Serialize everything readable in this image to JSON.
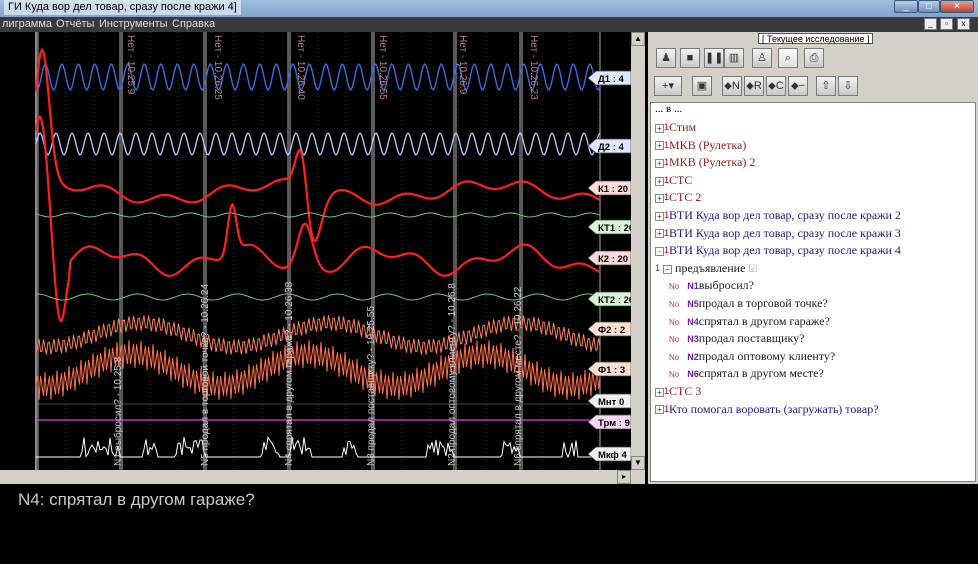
{
  "window": {
    "title": "ГИ Куда вор дел товар, сразу после кражи  4]",
    "controls": [
      "_",
      "□",
      "✕"
    ]
  },
  "menu": [
    "лиграмма",
    "Отчёты",
    "Инструменты",
    "Справка"
  ],
  "mdi_controls": [
    "_",
    "▫",
    "x"
  ],
  "channels": [
    {
      "label": "Д1 : 4",
      "color": "#4a78e0"
    },
    {
      "label": "Д2 : 4",
      "color": "#9ec8ff"
    },
    {
      "label": "К1 : 20",
      "color": "#ff2a2a"
    },
    {
      "label": "КТ1 : 20",
      "color": "#7fd17f"
    },
    {
      "label": "К2 : 20",
      "color": "#ff2a2a"
    },
    {
      "label": "КТ2 : 20",
      "color": "#7fd17f"
    },
    {
      "label": "Ф2 : 2",
      "color": "#ff8a66"
    },
    {
      "label": "Ф1 : 3",
      "color": "#ff8a66"
    },
    {
      "label": "Мнт 0",
      "color": "#ffffff"
    },
    {
      "label": "Трм : 9",
      "color": "#e040e0"
    },
    {
      "label": "Мкф 4",
      "color": "#ffffff"
    }
  ],
  "markers_top": [
    "Нет - 10.25.9",
    "Нет - 10.26.25",
    "Нет - 10.26.40",
    "Нет - 10.26.55",
    "Нет - 10.26.9",
    "Нет - 10.26.23"
  ],
  "markers_bottom": [
    "N1 выбросил? - 10.25.8",
    "N5 продал в торговой точке? - 10.26.24",
    "N4 спрятал в другом гараже? - 10.26.38",
    "N3 продал поставщику? - 10.25.55",
    "N2 продал оптовому клиенту? - 10.26.8",
    "N6 спрятал в другом месте? - 10.26.22"
  ],
  "right_panel": {
    "header": "[ Текущее исследование ]",
    "tree_partial_top": "... в ..."
  },
  "tree": [
    {
      "label": "Стим",
      "color": "dark-red",
      "expander": "+"
    },
    {
      "label": "МКВ (Рулетка)",
      "color": "dark-red",
      "expander": "+"
    },
    {
      "label": "МКВ (Рулетка) 2",
      "color": "dark-red",
      "expander": "+"
    },
    {
      "label": "СТС",
      "color": "dark-red",
      "expander": "+"
    },
    {
      "label": "СТС 2",
      "color": "dark-red",
      "expander": "+"
    },
    {
      "label": "ВТИ Куда вор дел товар, сразу после кражи 2",
      "color": "dark-blue",
      "expander": "+"
    },
    {
      "label": "ВТИ Куда вор дел товар, сразу после кражи  3",
      "color": "dark-blue",
      "expander": "+"
    },
    {
      "label": "ВТИ Куда вор дел товар, сразу после кражи  4",
      "color": "dark-blue",
      "expander": "-"
    }
  ],
  "subtree": {
    "root": "предъявление",
    "root_mark": "1",
    "items": [
      {
        "no": "No",
        "n": "N1",
        "label": "выбросил?"
      },
      {
        "no": "No",
        "n": "N5",
        "label": "продал в торговой точке?"
      },
      {
        "no": "No",
        "n": "N4",
        "label": "спрятал в другом гараже?"
      },
      {
        "no": "No",
        "n": "N3",
        "label": "продал поставщику?"
      },
      {
        "no": "No",
        "n": "N2",
        "label": "продал оптовому клиенту?"
      },
      {
        "no": "No",
        "n": "N6",
        "label": "спрятал в другом месте?"
      }
    ]
  },
  "tree_after": [
    {
      "label": "СТС 3",
      "color": "dark-red",
      "expander": "+"
    },
    {
      "label": "Кто помогал воровать (загружать) товар?",
      "color": "dark-blue",
      "expander": "+"
    }
  ],
  "status": "N4: спрятал в другом гараже?"
}
